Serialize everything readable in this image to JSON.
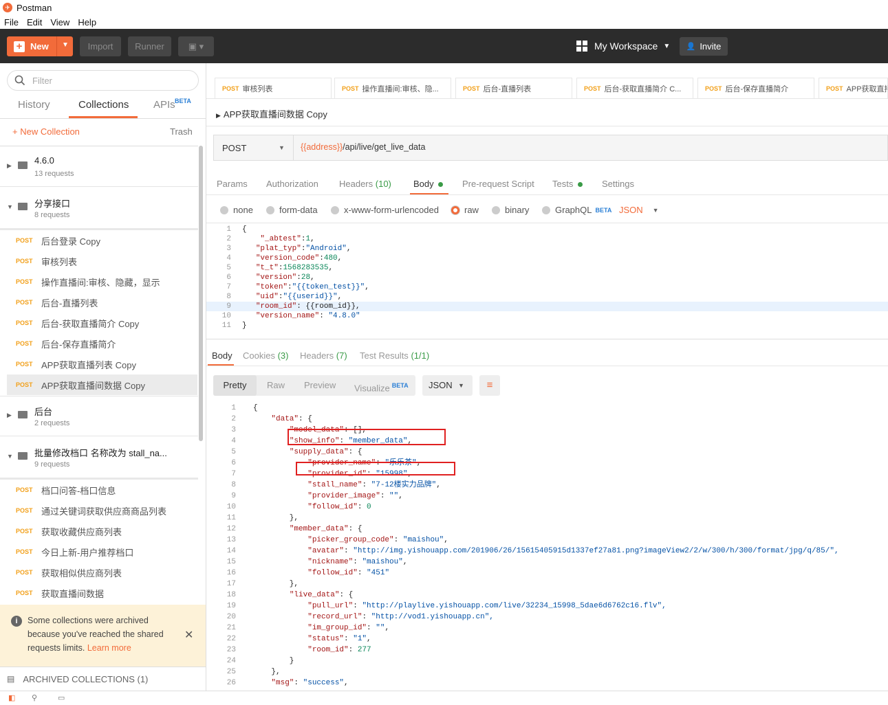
{
  "app": {
    "title": "Postman",
    "menu": [
      "File",
      "Edit",
      "View",
      "Help"
    ]
  },
  "toolbar": {
    "new_label": "New",
    "import_label": "Import",
    "runner_label": "Runner",
    "workspace_label": "My Workspace",
    "invite_label": "Invite"
  },
  "sidebar": {
    "filter_placeholder": "Filter",
    "tabs": [
      "History",
      "Collections",
      "APIs"
    ],
    "apis_badge": "BETA",
    "new_collection": "+ New Collection",
    "trash": "Trash",
    "folders": [
      {
        "name": "4.6.0",
        "sub": "13 requests"
      },
      {
        "name": "分享接口",
        "sub": "8 requests"
      },
      {
        "name": "后台",
        "sub": "2 requests"
      },
      {
        "name": "批量修改档口 名称改为 stall_na...",
        "sub": "9 requests"
      }
    ],
    "group1": [
      {
        "method": "POST",
        "name": "后台登录 Copy"
      },
      {
        "method": "POST",
        "name": "审核列表"
      },
      {
        "method": "POST",
        "name": "操作直播间:审核、隐藏，显示"
      },
      {
        "method": "POST",
        "name": "后台-直播列表"
      },
      {
        "method": "POST",
        "name": "后台-获取直播简介 Copy"
      },
      {
        "method": "POST",
        "name": "后台-保存直播简介"
      },
      {
        "method": "POST",
        "name": "APP获取直播列表 Copy"
      },
      {
        "method": "POST",
        "name": "APP获取直播间数据 Copy"
      }
    ],
    "group2": [
      {
        "method": "POST",
        "name": "档口问答-档口信息"
      },
      {
        "method": "POST",
        "name": "通过关键词获取供应商商品列表"
      },
      {
        "method": "POST",
        "name": "获取收藏供应商列表"
      },
      {
        "method": "POST",
        "name": "今日上新-用户推荐档口"
      },
      {
        "method": "POST",
        "name": "获取相似供应商列表"
      },
      {
        "method": "POST",
        "name": "获取直播间数据"
      }
    ],
    "notice_text": "Some collections were archived because you've reached the shared requests limits.",
    "notice_link": "Learn more",
    "archived": "ARCHIVED COLLECTIONS (1)"
  },
  "request_tabs": [
    {
      "method": "POST",
      "name": "审核列表"
    },
    {
      "method": "POST",
      "name": "操作直播间:审核、隐..."
    },
    {
      "method": "POST",
      "name": "后台-直播列表"
    },
    {
      "method": "POST",
      "name": "后台-获取直播简介 C..."
    },
    {
      "method": "POST",
      "name": "后台-保存直播简介"
    },
    {
      "method": "POST",
      "name": "APP获取直播"
    }
  ],
  "request": {
    "title": "APP获取直播间数据 Copy",
    "method": "POST",
    "url_var": "{{address}}",
    "url_path": "/api/live/get_live_data",
    "tabs": {
      "params": "Params",
      "auth": "Authorization",
      "headers": "Headers",
      "headers_count": "(10)",
      "body": "Body",
      "prereq": "Pre-request Script",
      "tests": "Tests",
      "settings": "Settings"
    },
    "body_types": {
      "none": "none",
      "form": "form-data",
      "urlenc": "x-www-form-urlencoded",
      "raw": "raw",
      "binary": "binary",
      "graphql": "GraphQL",
      "graphql_badge": "BETA",
      "format": "JSON"
    },
    "body_lines": [
      "{",
      "    \"_abtest\":1,",
      "   \"plat_typ\":\"Android\",",
      "   \"version_code\":480,",
      "   \"t_t\":1568283535,",
      "   \"version\":28,",
      "   \"token\":\"{{token_test}}\",",
      "   \"uid\":\"{{userid}}\",",
      "   \"room_id\": {{room_id}},",
      "   \"version_name\": \"4.8.0\"",
      "}"
    ]
  },
  "response": {
    "tabs": {
      "body": "Body",
      "cookies": "Cookies",
      "cookies_count": "(3)",
      "headers": "Headers",
      "headers_count": "(7)",
      "tests": "Test Results",
      "tests_count": "(1/1)"
    },
    "views": {
      "pretty": "Pretty",
      "raw": "Raw",
      "preview": "Preview",
      "visualize": "Visualize",
      "visualize_badge": "BETA",
      "format": "JSON"
    },
    "lines": [
      "{",
      "    \"data\": {",
      "        \"model_data\": [],",
      "        \"show_info\": \"member_data\",",
      "        \"supply_data\": {",
      "            \"provider_name\": \"乐乐茶\",",
      "            \"provider_id\": \"15998\",",
      "            \"stall_name\": \"7-12楼实力品牌\",",
      "            \"provider_image\": \"\",",
      "            \"follow_id\": 0",
      "        },",
      "        \"member_data\": {",
      "            \"picker_group_code\": \"maishou\",",
      "            \"avatar\": \"http://img.yishouapp.com/201906/26/15615405915d1337ef27a81.png?imageView2/2/w/300/h/300/format/jpg/q/85/\",",
      "            \"nickname\": \"maishou\",",
      "            \"follow_id\": \"451\"",
      "        },",
      "        \"live_data\": {",
      "            \"pull_url\": \"http://playlive.yishouapp.com/live/32234_15998_5dae6d6762c16.flv\",",
      "            \"record_url\": \"http://vod1.yishouapp.cn\",",
      "            \"im_group_id\": \"\",",
      "            \"status\": \"1\",",
      "            \"room_id\": 277",
      "        }",
      "    },",
      "    \"msg\": \"success\","
    ]
  },
  "colors": {
    "accent": "#f26b3a",
    "method": "#f2a01a",
    "highlight_box": "#e02020"
  }
}
